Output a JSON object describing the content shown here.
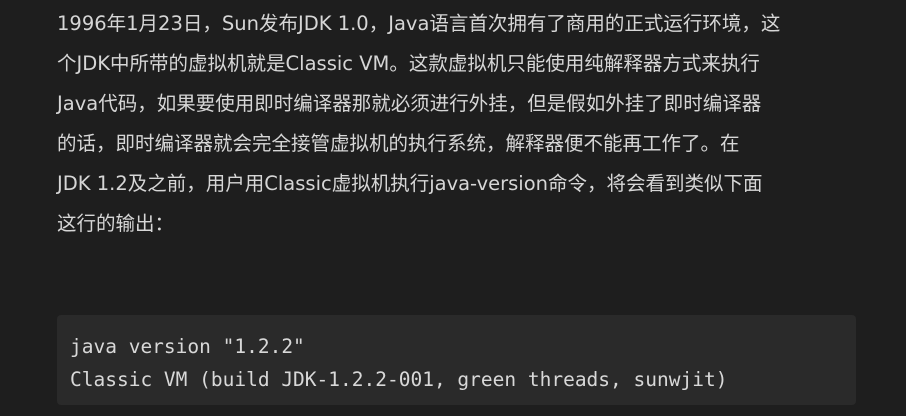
{
  "article": {
    "paragraph_lines": [
      "1996年1月23日，Sun发布JDK 1.0，Java语言首次拥有了商用的正式运行环境，这",
      "个JDK中所带的虚拟机就是Classic VM。这款虚拟机只能使用纯解释器方式来执行",
      "Java代码，如果要使用即时编译器那就必须进行外挂，但是假如外挂了即时编译器",
      "的话，即时编译器就会完全接管虚拟机的执行系统，解释器便不能再工作了。在",
      "JDK 1.2及之前，用户用Classic虚拟机执行java-version命令，将会看到类似下面",
      "这行的输出："
    ],
    "code_lines": [
      "java version \"1.2.2\"",
      "Classic VM (build JDK-1.2.2-001, green threads, sunwjit)"
    ]
  }
}
